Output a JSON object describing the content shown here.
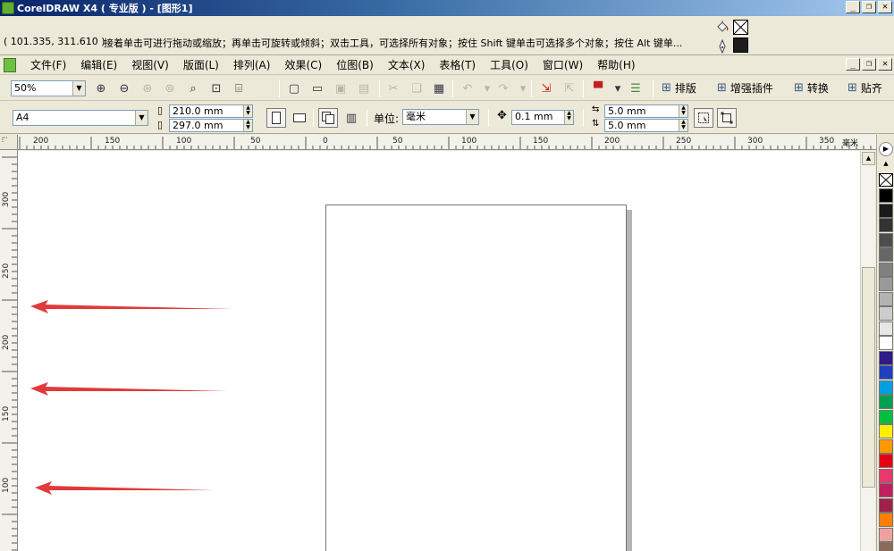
{
  "window": {
    "title": "CorelDRAW X4 ( 专业版 ) - [图形1]",
    "min_glyph": "_",
    "max_glyph": "❐",
    "close_glyph": "✕"
  },
  "hint_bar": {
    "coords": "( 101.335, 311.610 )",
    "hint": "接着单击可进行拖动或缩放；再单击可旋转或倾斜；双击工具，可选择所有对象；按住 Shift 键单击可选择多个对象；按住 Alt 键单..."
  },
  "menu": {
    "items": [
      "文件(F)",
      "编辑(E)",
      "视图(V)",
      "版面(L)",
      "排列(A)",
      "效果(C)",
      "位图(B)",
      "文本(X)",
      "表格(T)",
      "工具(O)",
      "窗口(W)",
      "帮助(H)"
    ]
  },
  "toolbar": {
    "zoom_value": "50%",
    "arrange_label": "排版",
    "plugin_label": "增强插件",
    "convert_label": "转换",
    "paste_label": "贴齐"
  },
  "propbar": {
    "paper_size": "A4",
    "width": "210.0 mm",
    "height": "297.0 mm",
    "units_label": "单位:",
    "units_value": "毫米",
    "nudge": "0.1 mm",
    "dup_x": "5.0 mm",
    "dup_y": "5.0 mm"
  },
  "ruler": {
    "unit": "毫米",
    "top_labels": [
      "200",
      "150",
      "100",
      "50",
      "0",
      "50",
      "100",
      "150",
      "200",
      "250",
      "300",
      "350"
    ],
    "left_labels": [
      "300",
      "250",
      "200",
      "150",
      "100"
    ]
  },
  "palette_colors": [
    "#000000",
    "#1a1a1a",
    "#333333",
    "#4d4d4d",
    "#666666",
    "#808080",
    "#999999",
    "#b3b3b3",
    "#cccccc",
    "#e6e6e6",
    "#ffffff",
    "#2e1a8a",
    "#1f3fbf",
    "#00a0e0",
    "#00a050",
    "#00c040",
    "#ffee00",
    "#ff9900",
    "#e60012",
    "#e8386c",
    "#c02060",
    "#a0204a",
    "#ff8000",
    "#f0a0a0",
    "#8a6a5a",
    "#b0a0d0",
    "#9080c0",
    "#7060b0"
  ]
}
